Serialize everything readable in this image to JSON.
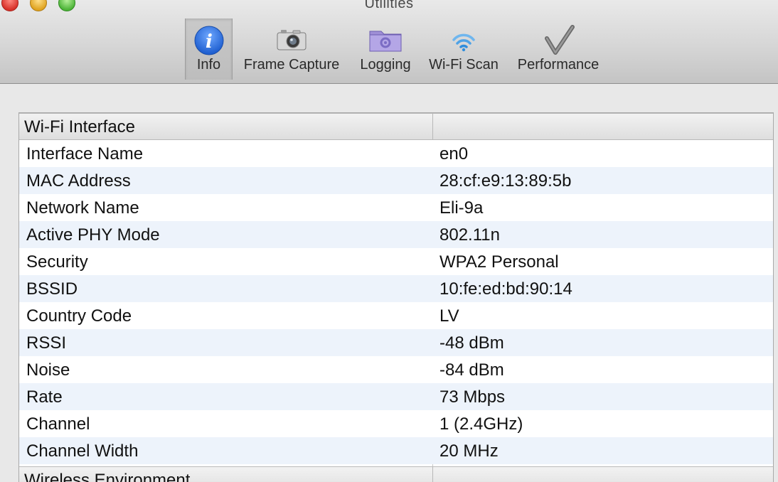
{
  "window": {
    "title": "Utilities"
  },
  "toolbar": {
    "items": [
      {
        "label": "Info",
        "icon": "info-icon",
        "selected": true
      },
      {
        "label": "Frame Capture",
        "icon": "camera-icon",
        "selected": false
      },
      {
        "label": "Logging",
        "icon": "folder-gear-icon",
        "selected": false
      },
      {
        "label": "Wi-Fi Scan",
        "icon": "wifi-icon",
        "selected": false
      },
      {
        "label": "Performance",
        "icon": "checkmark-icon",
        "selected": false
      }
    ]
  },
  "table": {
    "groups": [
      {
        "title": "Wi-Fi Interface",
        "rows": [
          {
            "name": "Interface Name",
            "value": "en0"
          },
          {
            "name": "MAC Address",
            "value": "28:cf:e9:13:89:5b"
          },
          {
            "name": "Network Name",
            "value": "Eli-9a"
          },
          {
            "name": "Active PHY Mode",
            "value": "802.11n"
          },
          {
            "name": "Security",
            "value": "WPA2 Personal"
          },
          {
            "name": "BSSID",
            "value": "10:fe:ed:bd:90:14"
          },
          {
            "name": "Country Code",
            "value": "LV"
          },
          {
            "name": "RSSI",
            "value": "-48 dBm"
          },
          {
            "name": "Noise",
            "value": "-84 dBm"
          },
          {
            "name": "Rate",
            "value": "73 Mbps"
          },
          {
            "name": "Channel",
            "value": "1 (2.4GHz)"
          },
          {
            "name": "Channel Width",
            "value": "20 MHz"
          }
        ]
      },
      {
        "title": "Wireless Environment",
        "rows": []
      }
    ]
  },
  "colors": {
    "row_alt": "#edf3fb",
    "info_blue": "#2a6fd8"
  }
}
